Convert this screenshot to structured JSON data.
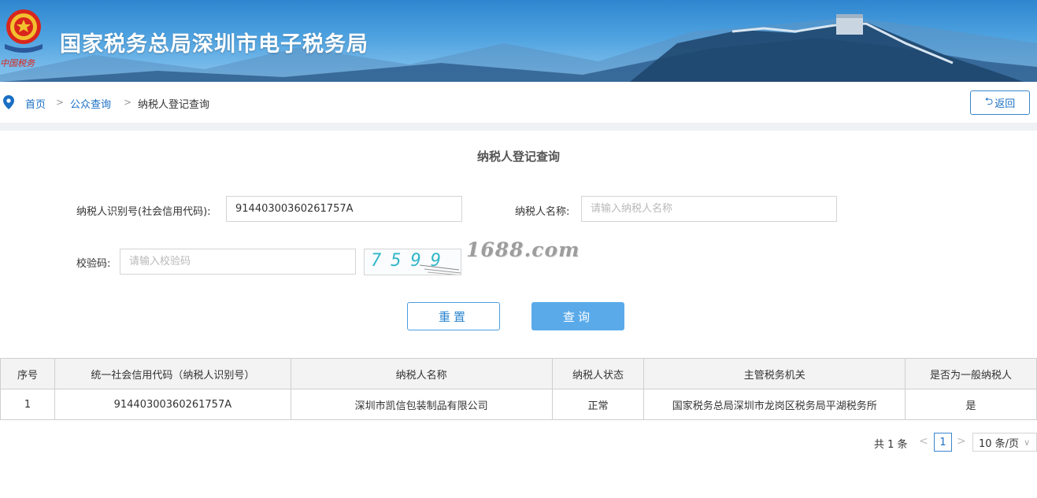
{
  "header": {
    "title": "国家税务总局深圳市电子税务局",
    "emblem_caption": "中国税务"
  },
  "breadcrumb": {
    "items": [
      {
        "label": "首页",
        "type": "link"
      },
      {
        "label": "公众查询",
        "type": "link"
      },
      {
        "label": "纳税人登记查询",
        "type": "current"
      }
    ],
    "separator": ">",
    "back_label": "返回"
  },
  "form": {
    "title": "纳税人登记查询",
    "taxpayer_id": {
      "label": "纳税人识别号(社会信用代码):",
      "value": "91440300360261757A",
      "placeholder": ""
    },
    "taxpayer_name": {
      "label": "纳税人名称:",
      "value": "",
      "placeholder": "请输入纳税人名称"
    },
    "captcha": {
      "label": "校验码:",
      "value": "",
      "placeholder": "请输入校验码",
      "image_text": "7599"
    },
    "reset_label": "重置",
    "search_label": "查询"
  },
  "watermark": "1688.com",
  "table": {
    "headers": [
      "序号",
      "统一社会信用代码（纳税人识别号）",
      "纳税人名称",
      "纳税人状态",
      "主管税务机关",
      "是否为一般纳税人"
    ],
    "rows": [
      [
        "1",
        "91440300360261757A",
        "深圳市凯信包装制品有限公司",
        "正常",
        "国家税务总局深圳市龙岗区税务局平湖税务所",
        "是"
      ]
    ]
  },
  "pagination": {
    "total_text": "共 1 条",
    "current_page": "1",
    "page_size": "10 条/页",
    "prev_icon": "chevron-left-icon",
    "next_icon": "chevron-right-icon"
  },
  "colors": {
    "accent": "#2f86cf",
    "link": "#1a6fc4",
    "search_button": "#5aaae9"
  }
}
